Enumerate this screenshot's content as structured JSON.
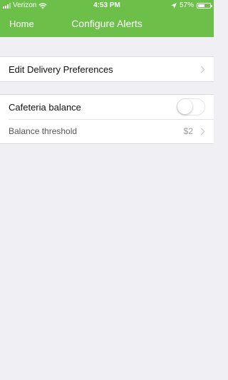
{
  "status_bar": {
    "carrier": "Verizon",
    "time": "4:53 PM",
    "battery_percent": "57%",
    "battery_level": 0.57,
    "icons": [
      "signal-bars-icon",
      "wifi-icon",
      "location-arrow-icon",
      "battery-icon"
    ]
  },
  "nav": {
    "back_label": "Home",
    "title": "Configure Alerts",
    "bar_color": "#6cc04a"
  },
  "rows": {
    "delivery": {
      "label": "Edit Delivery Preferences"
    },
    "cafeteria": {
      "label": "Cafeteria balance",
      "toggle_on": false
    },
    "threshold": {
      "label": "Balance threshold",
      "value": "$2"
    }
  }
}
